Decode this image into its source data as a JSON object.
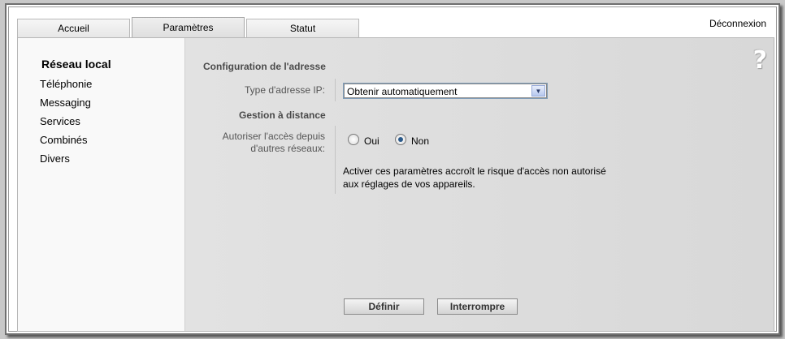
{
  "tabs": [
    {
      "label": "Accueil"
    },
    {
      "label": "Paramètres"
    },
    {
      "label": "Statut"
    }
  ],
  "header": {
    "logout": "Déconnexion"
  },
  "sidebar": {
    "items": [
      {
        "label": "Réseau local"
      },
      {
        "label": "Téléphonie"
      },
      {
        "label": "Messaging"
      },
      {
        "label": "Services"
      },
      {
        "label": "Combinés"
      },
      {
        "label": "Divers"
      }
    ]
  },
  "help": {
    "glyph": "?"
  },
  "address_config": {
    "title": "Configuration de l'adresse",
    "ip_type_label": "Type d'adresse IP:",
    "ip_type_value": "Obtenir automatiquement"
  },
  "remote": {
    "title": "Gestion à distance",
    "allow_label_line1": "Autoriser l'accès depuis",
    "allow_label_line2": "d'autres réseaux:",
    "option_yes": "Oui",
    "option_no": "Non",
    "selected": "Non",
    "warning_line1": "Activer ces paramètres accroît le risque d'accès non autorisé",
    "warning_line2": "aux réglages de vos appareils."
  },
  "actions": {
    "set": "Définir",
    "cancel": "Interrompre"
  }
}
